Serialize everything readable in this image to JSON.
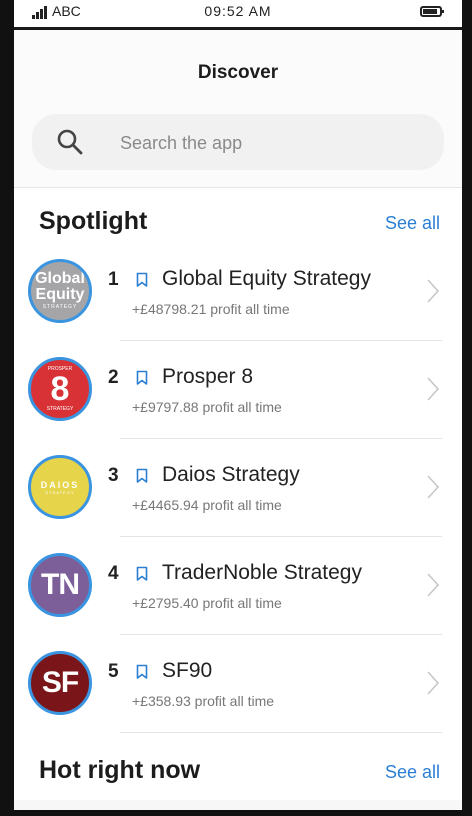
{
  "status_bar": {
    "carrier": "ABC",
    "time": "09:52 AM"
  },
  "header": {
    "title": "Discover"
  },
  "search": {
    "placeholder": "Search the app",
    "icon": "search-icon"
  },
  "spotlight": {
    "title": "Spotlight",
    "see_all": "See all",
    "items": [
      {
        "rank": "1",
        "name": "Global Equity Strategy",
        "profit": "+£48798.21 profit all time",
        "avatar_lines": [
          "Global",
          "Equity",
          "STRATEGY"
        ],
        "avatar_color": "#a5a5a8"
      },
      {
        "rank": "2",
        "name": "Prosper 8",
        "profit": "+£9797.88 profit all time",
        "avatar_lines": [
          "PROSPER",
          "8",
          "STRATEGY"
        ],
        "avatar_color": "#d83236"
      },
      {
        "rank": "3",
        "name": "Daios Strategy",
        "profit": "+£4465.94 profit all time",
        "avatar_lines": [
          "DAIOS",
          "STRATEGY"
        ],
        "avatar_color": "#e6d44a"
      },
      {
        "rank": "4",
        "name": "TraderNoble Strategy",
        "profit": "+£2795.40 profit all time",
        "avatar_lines": [
          "TN"
        ],
        "avatar_color": "#7c5e99"
      },
      {
        "rank": "5",
        "name": "SF90",
        "profit": "+£358.93 profit all time",
        "avatar_lines": [
          "SF"
        ],
        "avatar_color": "#7a1619"
      }
    ]
  },
  "hot": {
    "title": "Hot right now",
    "see_all": "See all"
  },
  "colors": {
    "accent": "#2a7fd4",
    "avatar_ring": "#3a94e0"
  }
}
